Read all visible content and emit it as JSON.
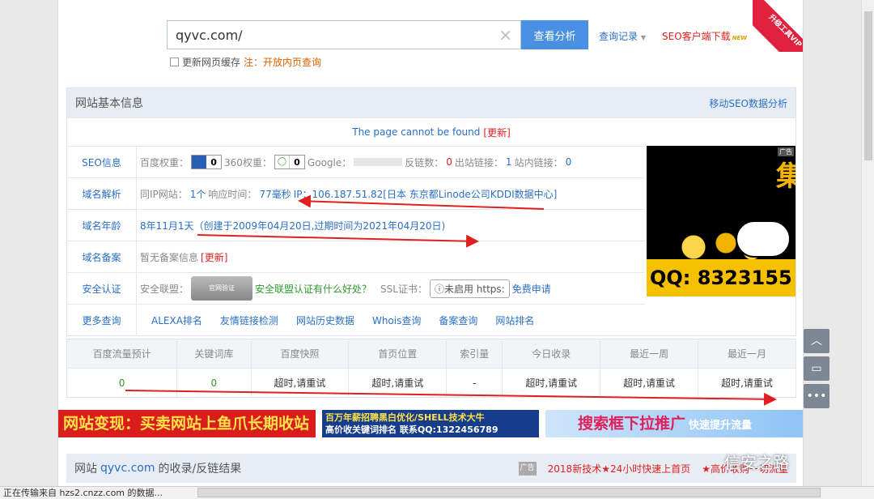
{
  "search": {
    "query": "qyvc.com/",
    "clear_icon": "close-icon",
    "analyze_label": "查看分析",
    "history_label": "查询记录",
    "client_label": "SEO客户端下载",
    "new_badge": "NEW",
    "vip_label": "升级工具VIP",
    "cache_label": "更新网页缓存",
    "cache_note": "注：开放内页查询"
  },
  "panel": {
    "title": "网站基本信息",
    "mobile_link": "移动SEO数据分析",
    "notfound": "The page cannot be found",
    "refresh": "[更新]"
  },
  "rows": {
    "seo": {
      "label": "SEO信息",
      "baidu_weight": "百度权重：",
      "baidu_num": "0",
      "w360": "360权重：",
      "w360_num": "0",
      "google": "Google：",
      "backlinks": "反链数：",
      "backlinks_num": "0",
      "outlinks": "出站链接：",
      "outlinks_num": "1",
      "inlinks": "站内链接：",
      "inlinks_num": "0"
    },
    "dns": {
      "label": "域名解析",
      "same_ip": "同IP网站：",
      "same_ip_num": "1个",
      "resp": "响应时间：",
      "resp_val": "77毫秒",
      "ip_val": "IP：106.187.51.82[日本 东京都Linode公司KDDI数据中心]"
    },
    "age": {
      "label": "域名年龄",
      "value": "8年11月1天（创建于2009年04月20日,过期时间为2021年04月20日)"
    },
    "icp": {
      "label": "域名备案",
      "value": "暂无备案信息",
      "refresh": "[更新]"
    },
    "security": {
      "label": "安全认证",
      "alliance": "安全联盟：",
      "badge": "官网验证",
      "question": "安全联盟认证有什么好处？",
      "ssl": "SSL证书：",
      "ssl_status": "ⓘ未启用 https:",
      "apply": "免费申请"
    },
    "more": {
      "label": "更多查询",
      "links": [
        "ALEXA排名",
        "友情链接检测",
        "网站历史数据",
        "Whois查询",
        "备案查询",
        "网站排名"
      ]
    }
  },
  "ad_right": {
    "tag": "广告",
    "big": "集",
    "qq": "QQ: 8323155"
  },
  "stats": {
    "headers": [
      "百度流量预计",
      "关键词库",
      "百度快照",
      "首页位置",
      "索引量",
      "今日收录",
      "最近一周",
      "最近一月"
    ],
    "values": [
      "0",
      "0",
      "超时,请重试",
      "超时,请重试",
      "-",
      "超时,请重试",
      "超时,请重试",
      "超时,请重试"
    ]
  },
  "banners": {
    "b1": "网站变现：买卖网站上鱼爪长期收站",
    "b2_line1": "百万年薪招聘黑白优化/SHELL技术大牛",
    "b2_line2": "高价收关键词排名 联系QQ:1322456789",
    "b3": "搜索框下拉推广",
    "b3_sub": "快速提升流量"
  },
  "results": {
    "prefix": "网站",
    "domain": "qyvc.com",
    "suffix": "的收录/反链结果",
    "ad_tag": "广告",
    "ad1": "2018新技术★24小时快速上首页",
    "ad2": "★高价收购一切流量"
  },
  "status": {
    "text": "正在传输来自 hzs2.cnzz.com 的数据..."
  },
  "watermark": "信安之路",
  "float_buttons": [
    "chevron-up-icon",
    "comment-icon",
    "more-icon"
  ]
}
